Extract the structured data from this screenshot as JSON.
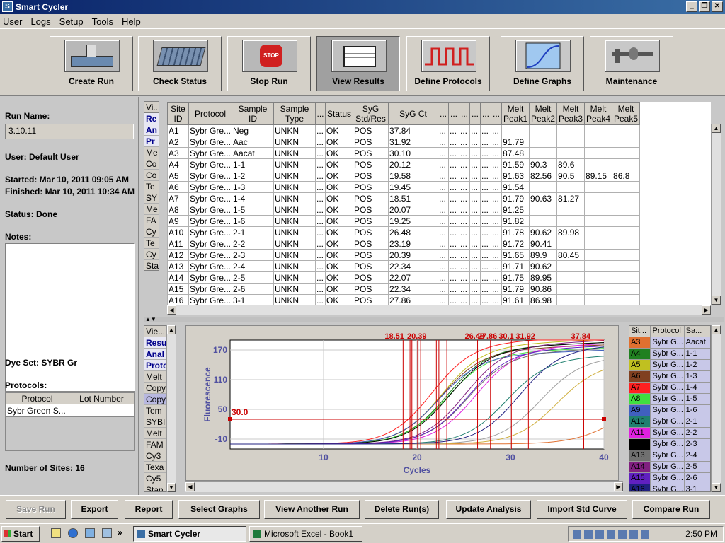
{
  "window": {
    "title": "Smart Cycler"
  },
  "menu": [
    "User",
    "Logs",
    "Setup",
    "Tools",
    "Help"
  ],
  "toolbar": [
    {
      "label": "Create Run",
      "icon": "create-run-icon"
    },
    {
      "label": "Check Status",
      "icon": "check-status-icon"
    },
    {
      "label": "Stop Run",
      "icon": "stop-sign-icon",
      "icon_text": "STOP"
    },
    {
      "label": "View Results",
      "icon": "view-results-icon"
    },
    {
      "label": "Define Protocols",
      "icon": "protocol-waveform-icon"
    },
    {
      "label": "Define Graphs",
      "icon": "graph-curve-icon"
    },
    {
      "label": "Maintenance",
      "icon": "caliper-icon"
    }
  ],
  "run": {
    "name_label": "Run Name:",
    "name": "3.10.11",
    "user": "User:  Default User",
    "started": "Started:  Mar 10, 2011 09:05 AM",
    "finished": "Finished:  Mar 10, 2011 10:34 AM",
    "status": "Status:  Done",
    "notes_label": "Notes:",
    "dye_set": "Dye Set:  SYBR Gr",
    "protocols_label": "Protocols:",
    "protocol_cols": [
      "Protocol",
      "Lot Number"
    ],
    "protocol_row": [
      "Sybr Green S...",
      ""
    ],
    "sites": "Number of Sites:  16"
  },
  "views_top": {
    "header": "Vi...",
    "items": [
      "Re",
      "An",
      "Pr",
      "Me",
      "Co",
      "Co",
      "Te",
      "SY",
      "Me",
      "FA",
      "Cy",
      "Te",
      "Cy",
      "Sta"
    ],
    "selected": [
      0,
      1,
      2
    ]
  },
  "results": {
    "headers": [
      "Site ID",
      "Protocol",
      "Sample ID",
      "Sample Type",
      "...",
      "Status",
      "SyG Std/Res",
      "SyG Ct",
      "...",
      "...",
      "...",
      "...",
      "...",
      "...",
      "Melt Peak1",
      "Melt Peak2",
      "Melt Peak3",
      "Melt Peak4",
      "Melt Peak5"
    ],
    "rows": [
      [
        "A1",
        "Sybr Gre...",
        "Neg",
        "UNKN",
        "...",
        "OK",
        "POS",
        "37.84",
        "...",
        "...",
        "...",
        "...",
        "...",
        "...",
        "",
        "",
        "",
        "",
        ""
      ],
      [
        "A2",
        "Sybr Gre...",
        "Aac",
        "UNKN",
        "...",
        "OK",
        "POS",
        "31.92",
        "...",
        "...",
        "...",
        "...",
        "...",
        "...",
        "91.79",
        "",
        "",
        "",
        ""
      ],
      [
        "A3",
        "Sybr Gre...",
        "Aacat",
        "UNKN",
        "...",
        "OK",
        "POS",
        "30.10",
        "...",
        "...",
        "...",
        "...",
        "...",
        "...",
        "87.48",
        "",
        "",
        "",
        ""
      ],
      [
        "A4",
        "Sybr Gre...",
        "1-1",
        "UNKN",
        "...",
        "OK",
        "POS",
        "20.12",
        "...",
        "...",
        "...",
        "...",
        "...",
        "...",
        "91.59",
        "90.3",
        "89.6",
        "",
        ""
      ],
      [
        "A5",
        "Sybr Gre...",
        "1-2",
        "UNKN",
        "...",
        "OK",
        "POS",
        "19.58",
        "...",
        "...",
        "...",
        "...",
        "...",
        "...",
        "91.63",
        "82.56",
        "90.5",
        "89.15",
        "86.8"
      ],
      [
        "A6",
        "Sybr Gre...",
        "1-3",
        "UNKN",
        "...",
        "OK",
        "POS",
        "19.45",
        "...",
        "...",
        "...",
        "...",
        "...",
        "...",
        "91.54",
        "",
        "",
        "",
        ""
      ],
      [
        "A7",
        "Sybr Gre...",
        "1-4",
        "UNKN",
        "...",
        "OK",
        "POS",
        "18.51",
        "...",
        "...",
        "...",
        "...",
        "...",
        "...",
        "91.79",
        "90.63",
        "81.27",
        "",
        ""
      ],
      [
        "A8",
        "Sybr Gre...",
        "1-5",
        "UNKN",
        "...",
        "OK",
        "POS",
        "20.07",
        "...",
        "...",
        "...",
        "...",
        "...",
        "...",
        "91.25",
        "",
        "",
        "",
        ""
      ],
      [
        "A9",
        "Sybr Gre...",
        "1-6",
        "UNKN",
        "...",
        "OK",
        "POS",
        "19.25",
        "...",
        "...",
        "...",
        "...",
        "...",
        "...",
        "91.82",
        "",
        "",
        "",
        ""
      ],
      [
        "A10",
        "Sybr Gre...",
        "2-1",
        "UNKN",
        "...",
        "OK",
        "POS",
        "26.48",
        "...",
        "...",
        "...",
        "...",
        "...",
        "...",
        "91.78",
        "90.62",
        "89.98",
        "",
        ""
      ],
      [
        "A11",
        "Sybr Gre...",
        "2-2",
        "UNKN",
        "...",
        "OK",
        "POS",
        "23.19",
        "...",
        "...",
        "...",
        "...",
        "...",
        "...",
        "91.72",
        "90.41",
        "",
        "",
        ""
      ],
      [
        "A12",
        "Sybr Gre...",
        "2-3",
        "UNKN",
        "...",
        "OK",
        "POS",
        "20.39",
        "...",
        "...",
        "...",
        "...",
        "...",
        "...",
        "91.65",
        "89.9",
        "80.45",
        "",
        ""
      ],
      [
        "A13",
        "Sybr Gre...",
        "2-4",
        "UNKN",
        "...",
        "OK",
        "POS",
        "22.34",
        "...",
        "...",
        "...",
        "...",
        "...",
        "...",
        "91.71",
        "90.62",
        "",
        "",
        ""
      ],
      [
        "A14",
        "Sybr Gre...",
        "2-5",
        "UNKN",
        "...",
        "OK",
        "POS",
        "22.07",
        "...",
        "...",
        "...",
        "...",
        "...",
        "...",
        "91.75",
        "89.95",
        "",
        "",
        ""
      ],
      [
        "A15",
        "Sybr Gre...",
        "2-6",
        "UNKN",
        "...",
        "OK",
        "POS",
        "22.34",
        "...",
        "...",
        "...",
        "...",
        "...",
        "...",
        "91.79",
        "90.86",
        "",
        "",
        ""
      ],
      [
        "A16",
        "Sybr Gre...",
        "3-1",
        "UNKN",
        "...",
        "OK",
        "POS",
        "27.86",
        "...",
        "...",
        "...",
        "...",
        "...",
        "...",
        "91.61",
        "86.98",
        "",
        "",
        ""
      ]
    ]
  },
  "views_bottom": {
    "header": "Vie...",
    "items": [
      "Resu",
      "Anal",
      "Proto",
      "Melt",
      "Copy",
      "Copy",
      "Tem",
      "SYBI",
      "Melt",
      "FAM",
      "Cy3",
      "Texa",
      "Cy5",
      "Stan"
    ],
    "selected": [
      0,
      1,
      2
    ],
    "highlight": 5
  },
  "chart_data": {
    "type": "line",
    "xlabel": "Cycles",
    "ylabel": "Fluorescence",
    "xlim": [
      0,
      40
    ],
    "ylim": [
      -30,
      190
    ],
    "xticks": [
      10,
      20,
      30,
      40
    ],
    "yticks": [
      -10,
      50,
      110,
      170
    ],
    "threshold": {
      "value": 30,
      "label": "30.0",
      "color": "#cc0000"
    },
    "ct_markers": [
      18.51,
      19.25,
      19.45,
      19.58,
      20.07,
      20.12,
      20.39,
      22.07,
      22.34,
      23.19,
      26.48,
      27.86,
      30.1,
      31.92,
      37.84
    ],
    "ct_labels_top": "18.51 19.25 19.45 19.58 20.07 20.12 20.39 22.07 22.34 23.19 26.48 27.86 30.10 31.92 37.84",
    "series": [
      {
        "site": "A1",
        "ct": 37.84,
        "plateau": 40,
        "color": "#e07030"
      },
      {
        "site": "A2",
        "ct": 31.92,
        "plateau": 120,
        "color": "#d0b040"
      },
      {
        "site": "A3",
        "ct": 30.1,
        "plateau": 130,
        "color": "#a0a0a0"
      },
      {
        "site": "A4",
        "ct": 20.12,
        "plateau": 150,
        "color": "#208020"
      },
      {
        "site": "A5",
        "ct": 19.58,
        "plateau": 155,
        "color": "#c0c020"
      },
      {
        "site": "A6",
        "ct": 19.45,
        "plateau": 145,
        "color": "#804020"
      },
      {
        "site": "A7",
        "ct": 18.51,
        "plateau": 160,
        "color": "#ff2020"
      },
      {
        "site": "A8",
        "ct": 20.07,
        "plateau": 140,
        "color": "#40e040"
      },
      {
        "site": "A9",
        "ct": 19.25,
        "plateau": 135,
        "color": "#4060c0"
      },
      {
        "site": "A10",
        "ct": 26.48,
        "plateau": 130,
        "color": "#208070"
      },
      {
        "site": "A11",
        "ct": 23.19,
        "plateau": 150,
        "color": "#e020e0"
      },
      {
        "site": "A12",
        "ct": 20.39,
        "plateau": 150,
        "color": "#000000"
      },
      {
        "site": "A13",
        "ct": 22.34,
        "plateau": 140,
        "color": "#707070"
      },
      {
        "site": "A14",
        "ct": 22.07,
        "plateau": 155,
        "color": "#802080"
      },
      {
        "site": "A15",
        "ct": 22.34,
        "plateau": 145,
        "color": "#6020c0"
      },
      {
        "site": "A16",
        "ct": 27.86,
        "plateau": 150,
        "color": "#202080"
      }
    ]
  },
  "legend": {
    "headers": [
      "Sit...",
      "Protocol",
      "Sa..."
    ],
    "rows": [
      {
        "site": "A3",
        "protocol": "Sybr G...",
        "sample": "Aacat",
        "color": "#e07030"
      },
      {
        "site": "A4",
        "protocol": "Sybr G...",
        "sample": "1-1",
        "color": "#208020"
      },
      {
        "site": "A5",
        "protocol": "Sybr G...",
        "sample": "1-2",
        "color": "#c0c020"
      },
      {
        "site": "A6",
        "protocol": "Sybr G...",
        "sample": "1-3",
        "color": "#804020"
      },
      {
        "site": "A7",
        "protocol": "Sybr G...",
        "sample": "1-4",
        "color": "#ff2020"
      },
      {
        "site": "A8",
        "protocol": "Sybr G...",
        "sample": "1-5",
        "color": "#40e040"
      },
      {
        "site": "A9",
        "protocol": "Sybr G...",
        "sample": "1-6",
        "color": "#4060c0"
      },
      {
        "site": "A10",
        "protocol": "Sybr G...",
        "sample": "2-1",
        "color": "#208070"
      },
      {
        "site": "A11",
        "protocol": "Sybr G...",
        "sample": "2-2",
        "color": "#e020e0"
      },
      {
        "site": "A12",
        "protocol": "Sybr G...",
        "sample": "2-3",
        "color": "#000000"
      },
      {
        "site": "A13",
        "protocol": "Sybr G...",
        "sample": "2-4",
        "color": "#707070"
      },
      {
        "site": "A14",
        "protocol": "Sybr G...",
        "sample": "2-5",
        "color": "#802080"
      },
      {
        "site": "A15",
        "protocol": "Sybr G...",
        "sample": "2-6",
        "color": "#6020c0"
      },
      {
        "site": "A16",
        "protocol": "Sybr G...",
        "sample": "3-1",
        "color": "#202080"
      }
    ]
  },
  "bottom_buttons": [
    {
      "label": "Save Run",
      "disabled": true
    },
    {
      "label": "Export"
    },
    {
      "label": "Report"
    },
    {
      "label": "Select Graphs"
    },
    {
      "label": "View Another Run"
    },
    {
      "label": "Delete Run(s)"
    },
    {
      "label": "Update Analysis"
    },
    {
      "label": "Import Std Curve"
    },
    {
      "label": "Compare Run"
    }
  ],
  "taskbar": {
    "start": "Start",
    "tasks": [
      {
        "label": "Smart Cycler",
        "active": true
      },
      {
        "label": "Microsoft Excel - Book1"
      }
    ],
    "clock": "2:50 PM",
    "quicklaunch_more": "»"
  }
}
